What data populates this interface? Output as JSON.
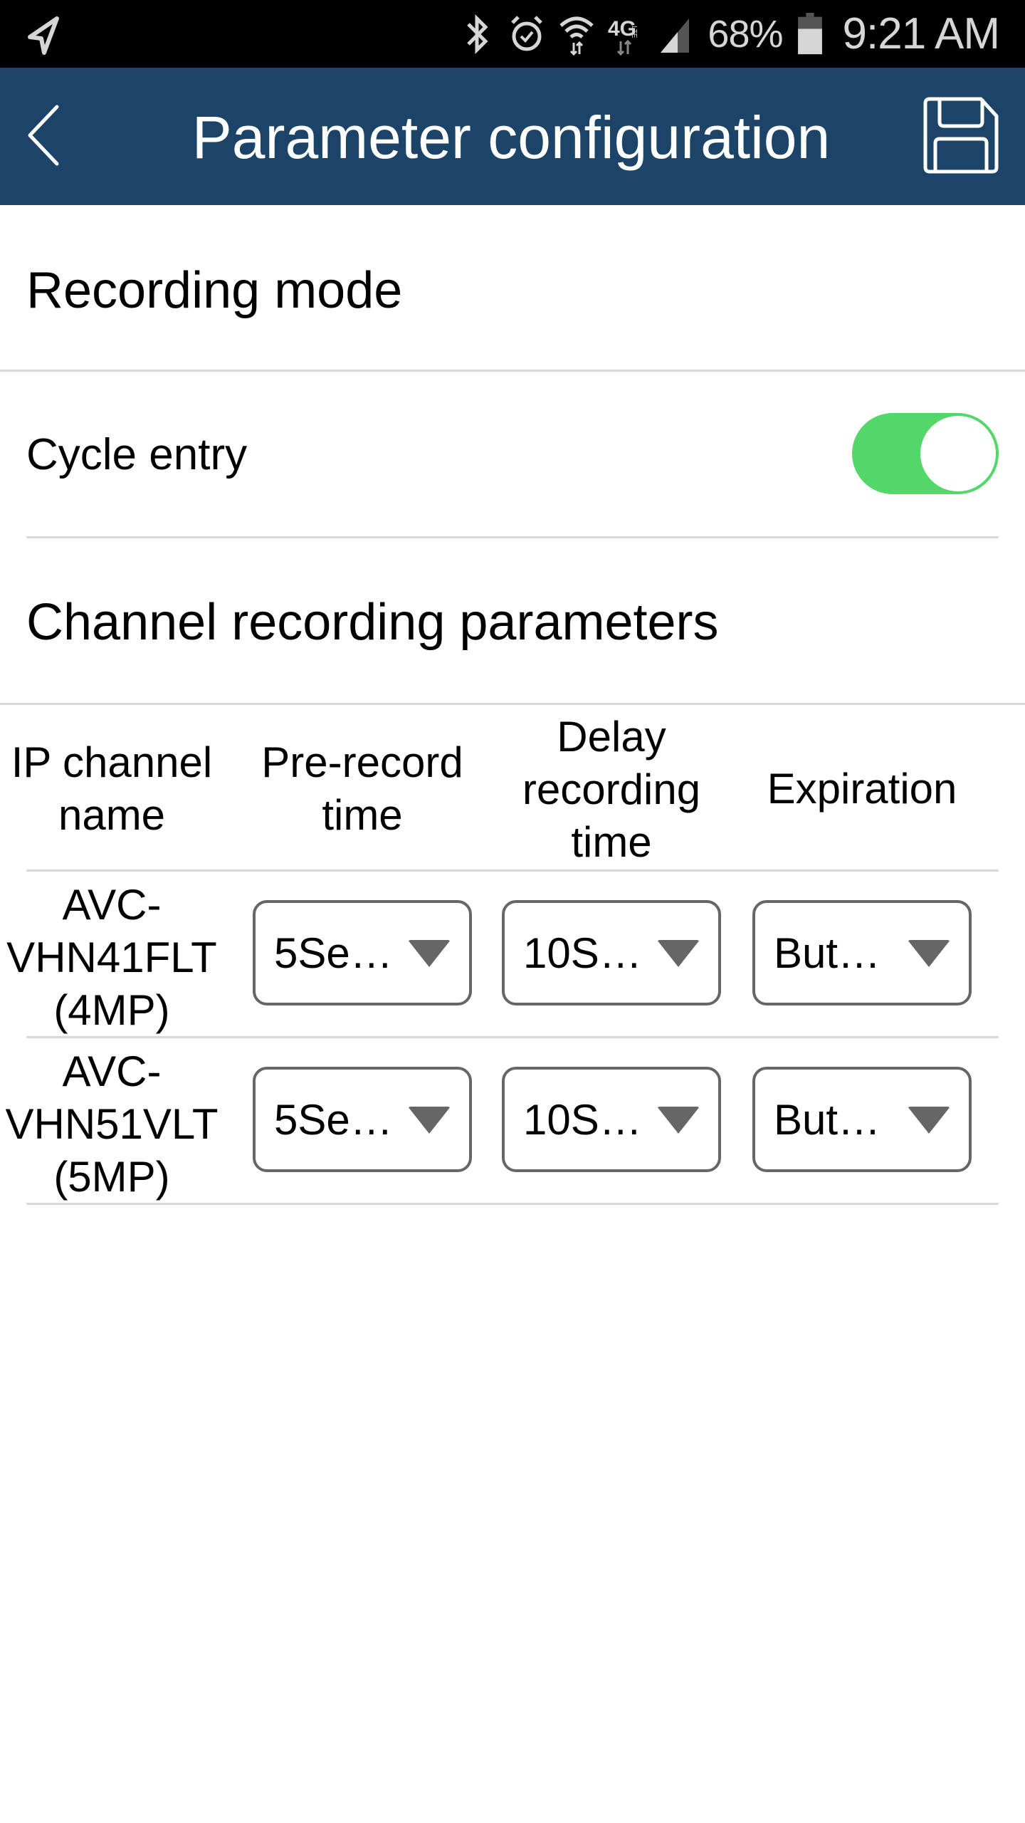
{
  "status_bar": {
    "left_icon": "navigation-arrow-icon",
    "icons": [
      "bluetooth-icon",
      "alarm-icon",
      "wifi-icon",
      "4g-lte-icon",
      "signal-icon"
    ],
    "battery_percent": "68%",
    "battery_level": 0.68,
    "time": "9:21 AM"
  },
  "header": {
    "title": "Parameter configuration",
    "back_icon": "chevron-left-icon",
    "save_icon": "floppy-disk-icon"
  },
  "recording_mode": {
    "title": "Recording mode",
    "cycle_entry": {
      "label": "Cycle entry",
      "enabled": true,
      "toggle_color": "#53d769"
    }
  },
  "channel_params": {
    "title": "Channel recording parameters",
    "columns": [
      {
        "line1": "IP channel",
        "line2": "name",
        "line3": ""
      },
      {
        "line1": "Pre-record",
        "line2": "time",
        "line3": ""
      },
      {
        "line1": "Delay",
        "line2": "recording",
        "line3": "time"
      },
      {
        "line1": "Expiration",
        "line2": "",
        "line3": ""
      }
    ],
    "rows": [
      {
        "name_line1": "AVC-",
        "name_line2": "VHN41FLT",
        "name_line3": "(4MP)",
        "pre_record": "5Se…",
        "delay_recording": "10S…",
        "expiration": "But…"
      },
      {
        "name_line1": "AVC-",
        "name_line2": "VHN51VLT",
        "name_line3": "(5MP)",
        "pre_record": "5Se…",
        "delay_recording": "10S…",
        "expiration": "But…"
      }
    ]
  },
  "colors": {
    "header_bg": "#1c4468",
    "divider": "#d9d9d9",
    "dropdown_border": "#666666",
    "toggle_on": "#53d769"
  }
}
